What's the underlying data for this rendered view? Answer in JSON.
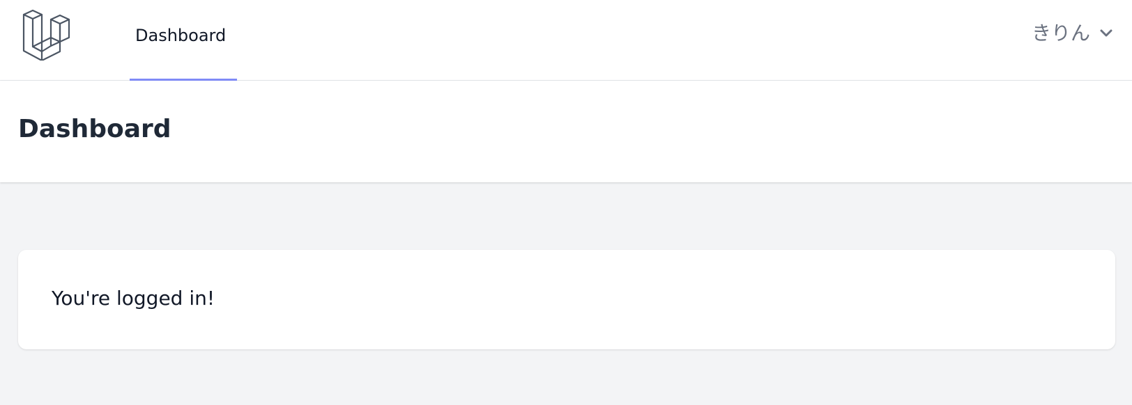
{
  "navigation": {
    "logo_icon": "laravel-logo-icon",
    "links": [
      {
        "label": "Dashboard",
        "active": true
      }
    ],
    "active_color": "#818cf8",
    "user_menu": {
      "name": "きりん",
      "icon": "chevron-down-icon"
    }
  },
  "header": {
    "title": "Dashboard"
  },
  "main": {
    "message": "You're logged in!"
  },
  "colors": {
    "background": "#f3f4f6",
    "surface": "#ffffff",
    "text_primary": "#111827",
    "text_muted": "#6b7280",
    "logo_stroke": "#4b5563"
  }
}
